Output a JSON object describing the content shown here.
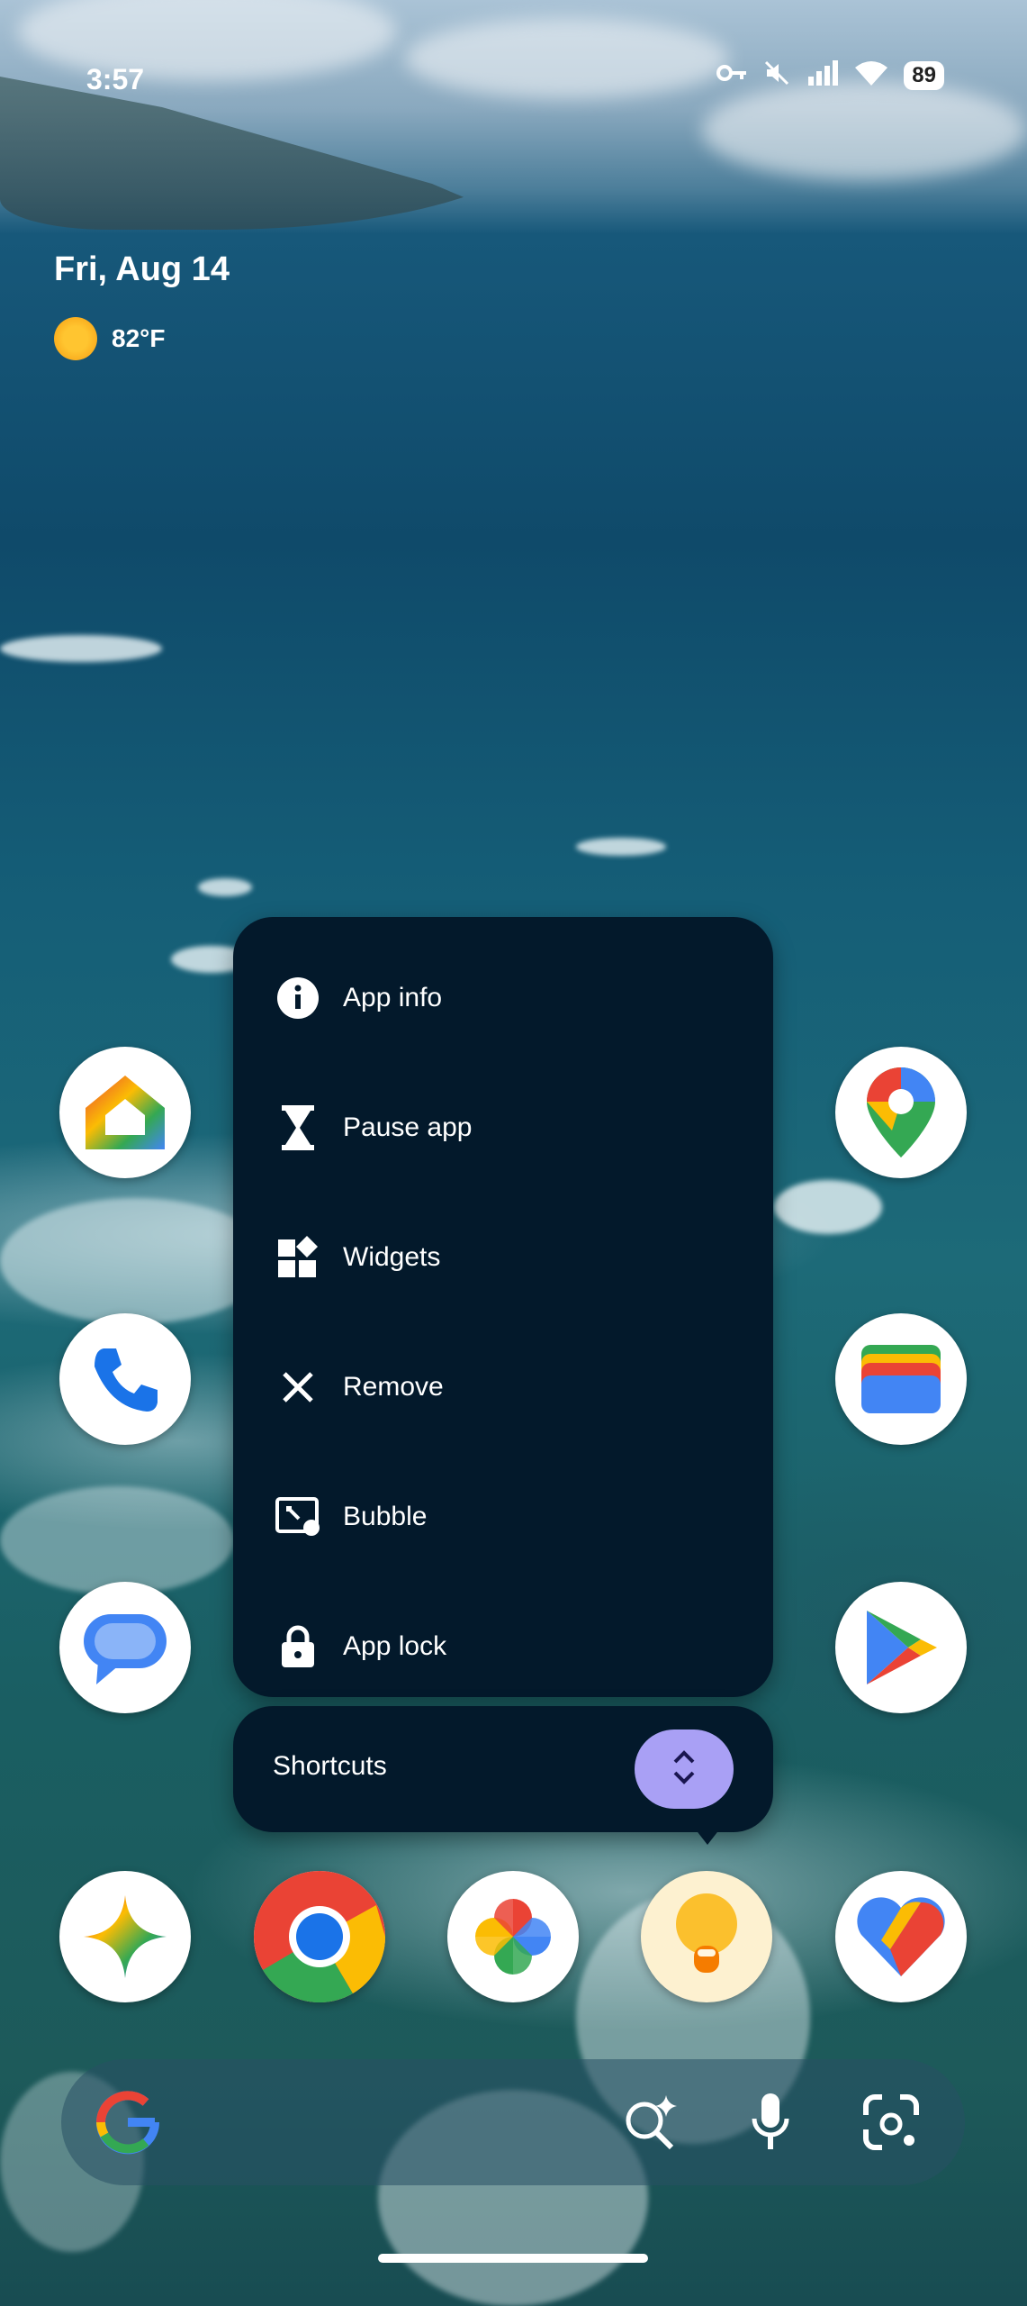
{
  "status_bar": {
    "time": "3:57",
    "battery": "89"
  },
  "widget": {
    "date": "Fri, Aug 14",
    "temperature": "82°F"
  },
  "menu": {
    "items": [
      {
        "label": "App info",
        "icon": "info-icon"
      },
      {
        "label": "Pause app",
        "icon": "hourglass-icon"
      },
      {
        "label": "Widgets",
        "icon": "widgets-icon"
      },
      {
        "label": "Remove",
        "icon": "close-icon"
      },
      {
        "label": "Bubble",
        "icon": "bubble-icon"
      },
      {
        "label": "App lock",
        "icon": "lock-icon"
      }
    ],
    "shortcuts_label": "Shortcuts"
  },
  "apps": {
    "row1": [
      "Google Home",
      "Google Maps"
    ],
    "row2": [
      "Phone",
      "Google Wallet"
    ],
    "row3": [
      "Messages",
      "Play Store"
    ],
    "dock": [
      "Gemini",
      "Chrome",
      "Photos",
      "Flashlight",
      "Fitbit"
    ]
  },
  "colors": {
    "menu_bg": "#03192b",
    "accent": "#a9a0f5"
  }
}
